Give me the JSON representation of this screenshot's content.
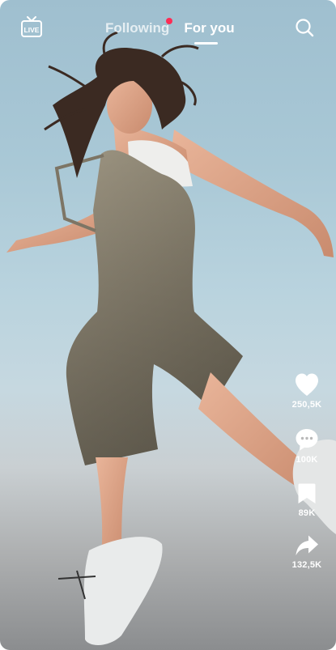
{
  "header": {
    "live_label": "LIVE",
    "tabs": [
      {
        "label": "Following",
        "has_notification_dot": true
      },
      {
        "label": "For you",
        "active": true
      }
    ]
  },
  "actions": {
    "like": {
      "icon": "heart-icon",
      "count": "250,5K"
    },
    "comment": {
      "icon": "comment-icon",
      "count": "100K"
    },
    "save": {
      "icon": "bookmark-icon",
      "count": "89K"
    },
    "share": {
      "icon": "share-icon",
      "count": "132,5K"
    }
  },
  "colors": {
    "notification_dot": "#fe2c55",
    "text": "#ffffff"
  }
}
